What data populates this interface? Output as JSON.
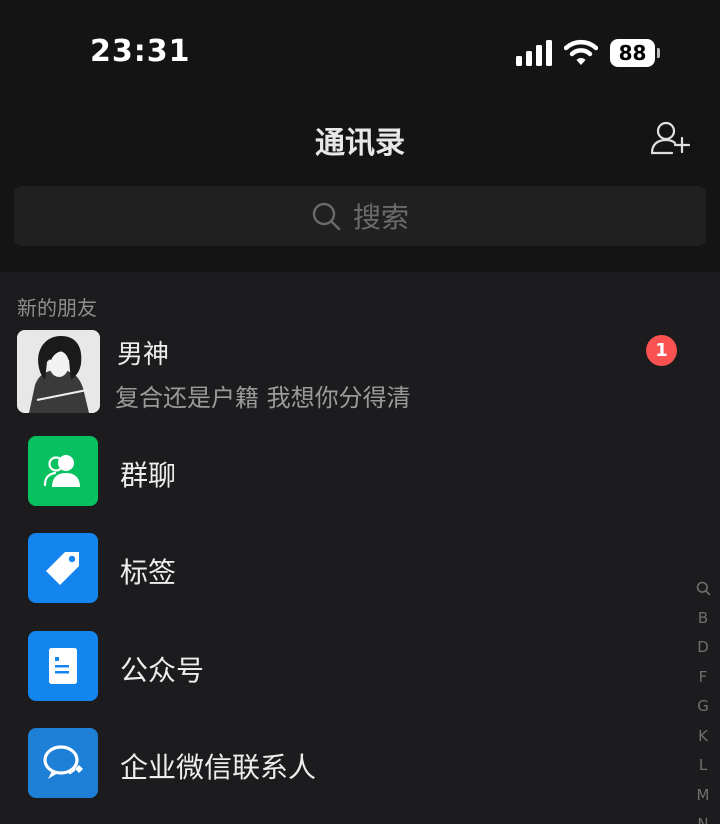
{
  "status_bar": {
    "time": "23:31",
    "battery": "88"
  },
  "nav": {
    "title": "通讯录",
    "add_contact_icon": "add-contact-icon"
  },
  "search": {
    "placeholder": "搜索",
    "icon": "search-icon"
  },
  "new_friends": {
    "section_label": "新的朋友",
    "name": "男神",
    "message": "复合还是户籍 我想你分得清",
    "badge": "1"
  },
  "entries": [
    {
      "label": "群聊",
      "icon": "group-chat-icon",
      "color": "#07c160"
    },
    {
      "label": "标签",
      "icon": "tag-icon",
      "color": "#1485ee"
    },
    {
      "label": "公众号",
      "icon": "official-account-icon",
      "color": "#1485ee"
    },
    {
      "label": "企业微信联系人",
      "icon": "wecom-icon",
      "color": "#1e7fd6"
    }
  ],
  "index_bar": [
    "Q",
    "B",
    "D",
    "F",
    "G",
    "K",
    "L",
    "M",
    "N"
  ]
}
